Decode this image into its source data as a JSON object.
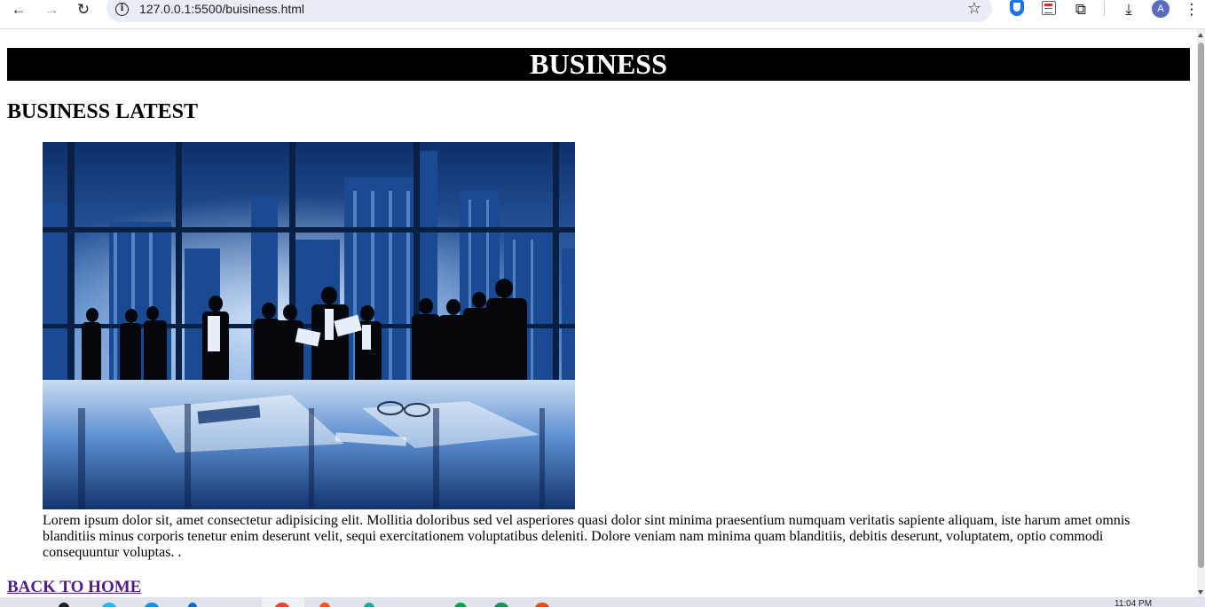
{
  "browser": {
    "back_icon": "←",
    "forward_icon": "→",
    "reload_icon": "↻",
    "url": "127.0.0.1:5500/buisiness.html",
    "star_icon": "☆",
    "puzzle_icon": "⧉",
    "download_icon": "⤓",
    "avatar_initial": "A",
    "menu_icon": "⋮"
  },
  "page": {
    "banner_title": "BUSINESS",
    "section_title": "BUSINESS LATEST",
    "image_alt": "business team meeting silhouettes against city skyline",
    "article_text": "Lorem ipsum dolor sit, amet consectetur adipisicing elit. Mollitia doloribus sed vel asperiores quasi dolor sint minima praesentium numquam veritatis sapiente aliquam, iste harum amet omnis blanditiis minus corporis tenetur enim deserunt velit, sequi exercitationem voluptatibus deleniti. Dolore veniam nam minima quam blanditiis, debitis deserunt, voluptatem, optio commodi consequuntur voluptas. .",
    "home_link": "BACK TO HOME"
  },
  "taskbar": {
    "clock": "11:04 PM"
  },
  "colors": {
    "banner_bg": "#000000",
    "banner_text": "#ffffff",
    "link_visited": "#551a8b",
    "omnibox_bg": "#e9eef6"
  }
}
